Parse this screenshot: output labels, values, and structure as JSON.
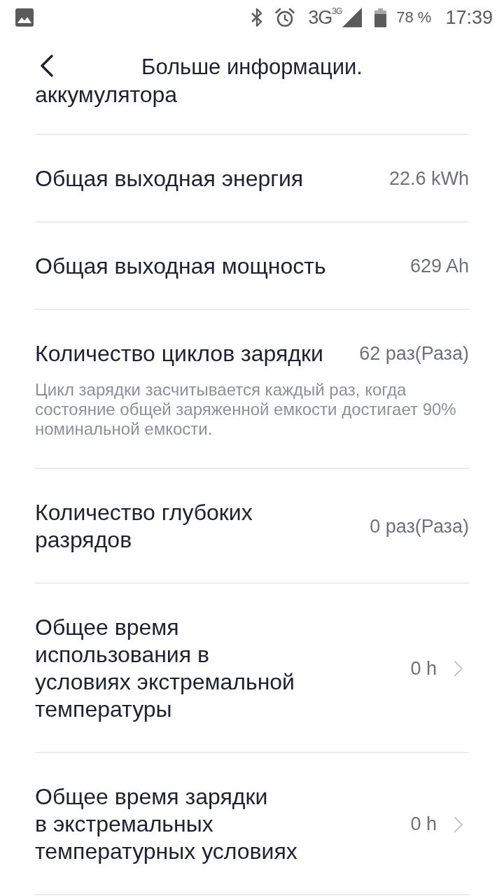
{
  "status_bar": {
    "network": "3G$^{3G}$",
    "battery": "78 %",
    "time": "17:39"
  },
  "header": {
    "title": "Больше информации."
  },
  "partial_row": {
    "label": "аккумулятора"
  },
  "rows": [
    {
      "kind": "info",
      "label": "Общая выходная энергия",
      "value": "22.6 kWh"
    },
    {
      "kind": "info",
      "label": "Общая выходная мощность",
      "value": "629 Ah"
    },
    {
      "kind": "info",
      "label": "Количество циклов зарядки",
      "value": "62 раз(Раза)",
      "note": "Цикл зарядки засчитывается каждый раз, когда состояние общей заряженной емкости достигает 90% номинальной емкости."
    },
    {
      "kind": "info",
      "label": "Количество глубоких\nразрядов",
      "value": "0 раз(Раза)"
    },
    {
      "kind": "nav",
      "label": "Общее время\nиспользования в\nусловиях экстремальной\nтемпературы",
      "value": "0 h"
    },
    {
      "kind": "nav",
      "label": "Общее время зарядки\nв экстремальных\nтемпературных условиях",
      "value": "0 h"
    }
  ]
}
